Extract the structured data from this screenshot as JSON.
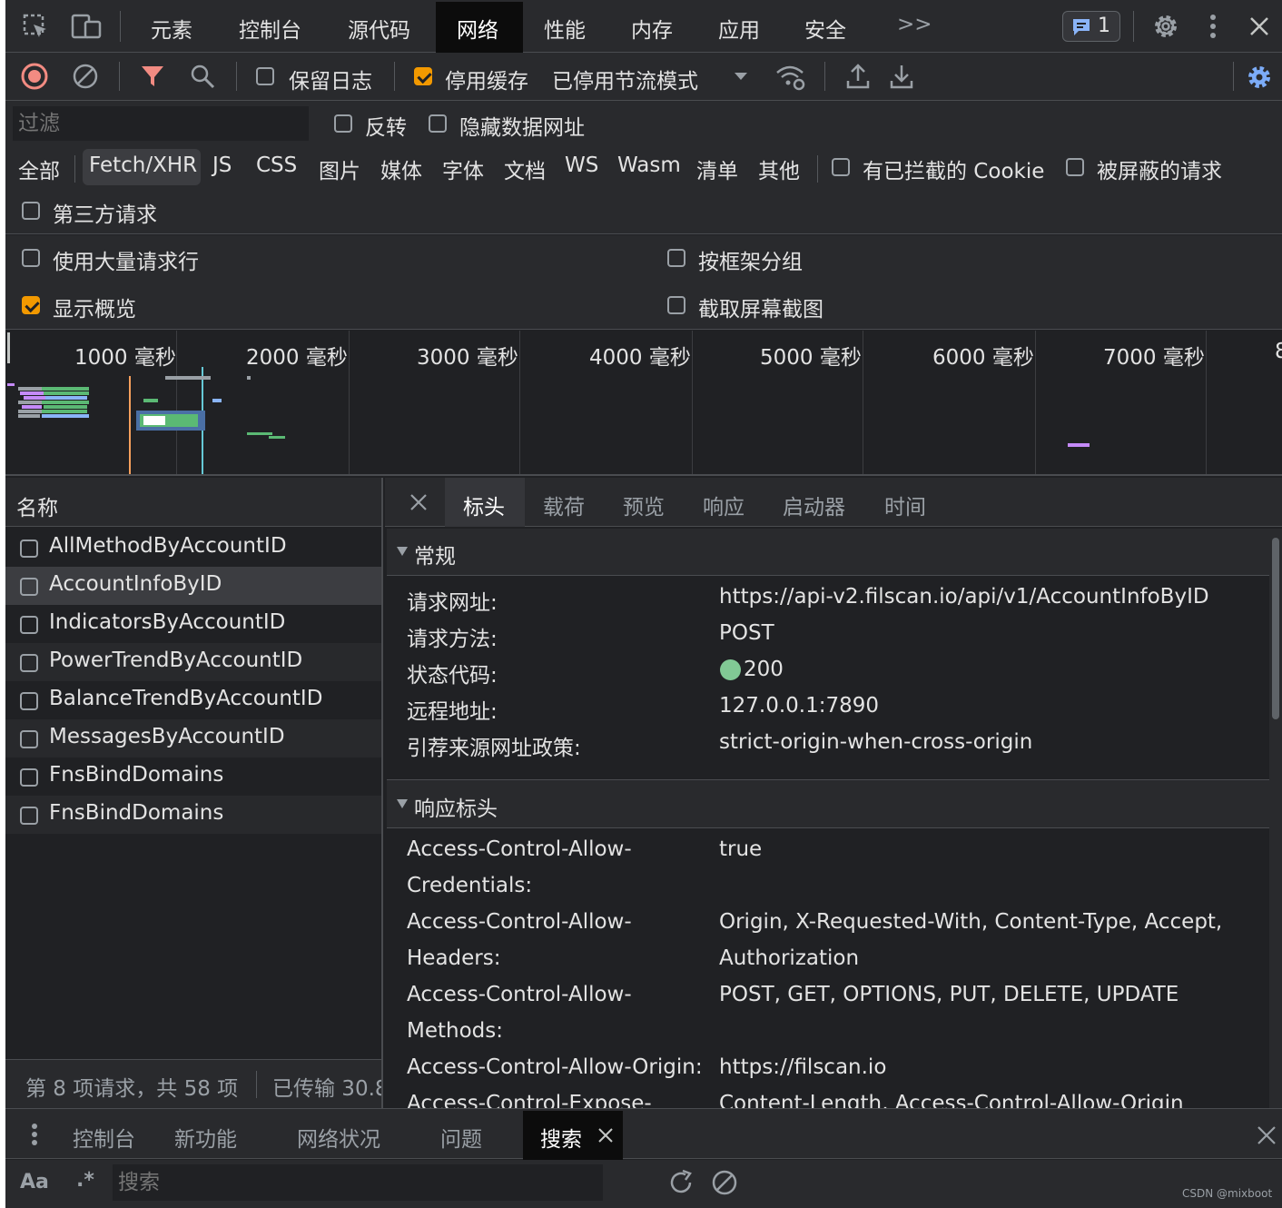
{
  "tabs": [
    "元素",
    "控制台",
    "源代码",
    "网络",
    "性能",
    "内存",
    "应用",
    "安全"
  ],
  "active_tab": "网络",
  "more_tabs": ">>",
  "issues_count": "1",
  "toolbar": {
    "preserve_log": "保留日志",
    "disable_cache": "停用缓存",
    "throttle": "已停用节流模式"
  },
  "filter": {
    "placeholder": "过滤",
    "invert": "反转",
    "hide_data_urls": "隐藏数据网址"
  },
  "types": [
    "全部",
    "Fetch/XHR",
    "JS",
    "CSS",
    "图片",
    "媒体",
    "字体",
    "文档",
    "WS",
    "Wasm",
    "清单",
    "其他"
  ],
  "blocked_cookies": "有已拦截的 Cookie",
  "blocked_requests": "被屏蔽的请求",
  "third_party": "第三方请求",
  "options": {
    "big_rows": "使用大量请求行",
    "group_by_frame": "按框架分组",
    "show_overview": "显示概览",
    "capture_screenshots": "截取屏幕截图"
  },
  "timeline_ticks": [
    "1000 毫秒",
    "2000 毫秒",
    "3000 毫秒",
    "4000 毫秒",
    "5000 毫秒",
    "6000 毫秒",
    "7000 毫秒",
    "8"
  ],
  "name_header": "名称",
  "requests": [
    "AllMethodByAccountID",
    "AccountInfoByID",
    "IndicatorsByAccountID",
    "PowerTrendByAccountID",
    "BalanceTrendByAccountID",
    "MessagesByAccountID",
    "FnsBindDomains",
    "FnsBindDomains"
  ],
  "status_left": "第 8 项请求，共 58 项",
  "status_right": "已传输 30.8",
  "detail_tabs": [
    "标头",
    "载荷",
    "预览",
    "响应",
    "启动器",
    "时间"
  ],
  "general": {
    "title": "常规",
    "rows": [
      {
        "k": "请求网址:",
        "v": "https://api-v2.filscan.io/api/v1/AccountInfoByID"
      },
      {
        "k": "请求方法:",
        "v": "POST"
      },
      {
        "k": "状态代码:",
        "v": "200"
      },
      {
        "k": "远程地址:",
        "v": "127.0.0.1:7890"
      },
      {
        "k": "引荐来源网址政策:",
        "v": "strict-origin-when-cross-origin"
      }
    ]
  },
  "response_headers": {
    "title": "响应标头",
    "rows": [
      {
        "k1": "Access-Control-Allow-",
        "k2": "Credentials:",
        "v1": "true",
        "v2": ""
      },
      {
        "k1": "Access-Control-Allow-",
        "k2": "Headers:",
        "v1": "Origin, X-Requested-With, Content-Type, Accept,",
        "v2": "Authorization"
      },
      {
        "k1": "Access-Control-Allow-",
        "k2": "Methods:",
        "v1": "POST, GET, OPTIONS, PUT, DELETE, UPDATE",
        "v2": ""
      },
      {
        "k1": "Access-Control-Allow-Origin:",
        "k2": "",
        "v1": "https://filscan.io",
        "v2": ""
      },
      {
        "k1": "Access-Control-Expose-",
        "k2": "",
        "v1": "Content-Length, Access-Control-Allow-Origin",
        "v2": ""
      }
    ]
  },
  "drawer_tabs": [
    "控制台",
    "新功能",
    "网络状况",
    "问题",
    "搜索"
  ],
  "search": {
    "case": "Aa",
    "regex": ".*",
    "placeholder": "搜索"
  },
  "watermark": "CSDN @mixboot"
}
